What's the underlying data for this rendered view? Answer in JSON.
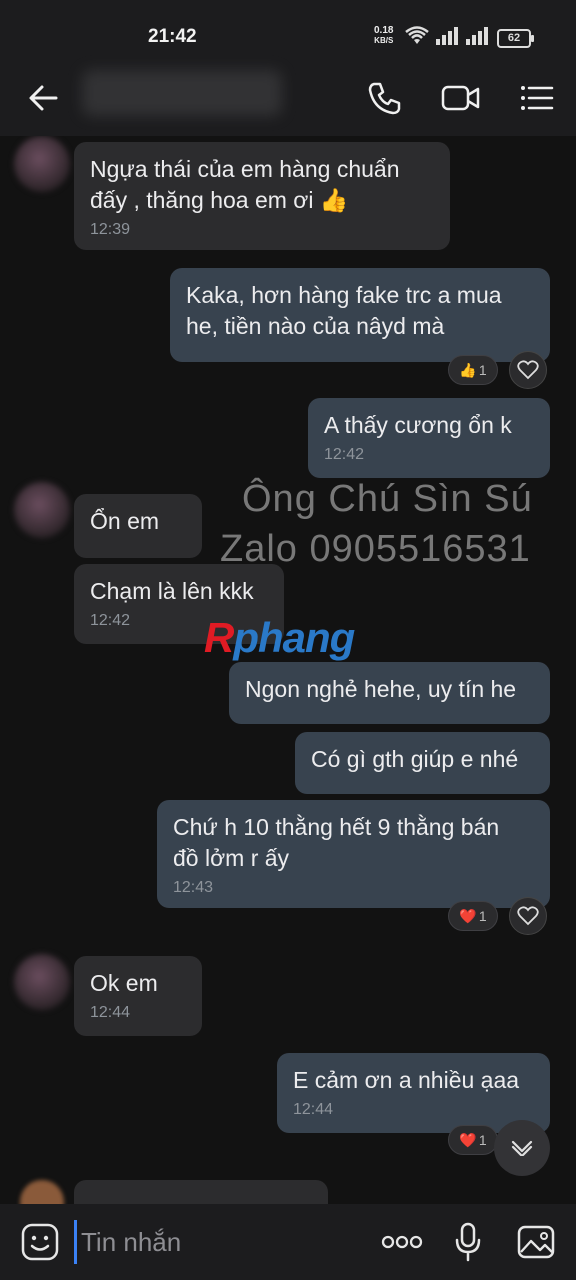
{
  "status_bar": {
    "time": "21:42",
    "net_speed_value": "0.18",
    "net_speed_unit": "KB/S",
    "battery": "62"
  },
  "header": {
    "contact_name": ""
  },
  "messages": [
    {
      "dir": "in",
      "text_lines": [
        "Ngựa thái của em hàng chuẩn",
        "đấy , thăng hoa em ơi 👍"
      ],
      "time": "12:39"
    },
    {
      "dir": "out",
      "text_lines": [
        "Kaka, hơn hàng fake trc a mua",
        "he, tiền nào của nâyd mà"
      ],
      "reaction": {
        "emoji": "👍",
        "count": "1"
      }
    },
    {
      "dir": "out",
      "text_lines": [
        "A thấy  cương ổn k"
      ],
      "time": "12:42"
    },
    {
      "dir": "in",
      "text_lines": [
        "Ổn em"
      ]
    },
    {
      "dir": "in",
      "text_lines": [
        "Chạm là lên kkk"
      ],
      "time": "12:42"
    },
    {
      "dir": "out",
      "text_lines": [
        "Ngon nghẻ hehe, uy tín he"
      ]
    },
    {
      "dir": "out",
      "text_lines": [
        "Có gì gth giúp e nhé"
      ]
    },
    {
      "dir": "out",
      "text_lines": [
        "Chứ h 10 thằng hết 9 thằng bán",
        "đồ lởm r ấy"
      ],
      "time": "12:43",
      "reaction": {
        "emoji": "❤️",
        "count": "1"
      }
    },
    {
      "dir": "in",
      "text_lines": [
        "Ok em"
      ],
      "time": "12:44"
    },
    {
      "dir": "out",
      "text_lines": [
        "E cảm ơn a nhiều ạaa"
      ],
      "time": "12:44",
      "reaction": {
        "emoji": "❤️",
        "count": "1"
      }
    }
  ],
  "watermark": {
    "line1": "Ông Chú Sìn Sú",
    "line2": "Zalo 0905516531",
    "logo_red": "R",
    "logo_blue": "phang"
  },
  "composer": {
    "placeholder": "Tin nhắn"
  },
  "colors": {
    "incoming_bubble": "#2c2c2e",
    "outgoing_bubble": "#38434f",
    "background": "#121212",
    "cursor": "#3b82f6"
  }
}
